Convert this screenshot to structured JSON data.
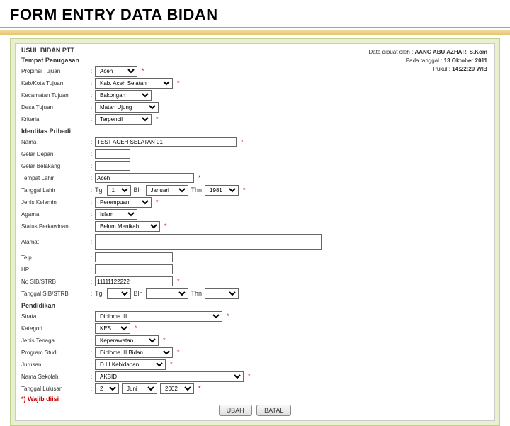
{
  "title": "FORM ENTRY DATA BIDAN",
  "form_header": "USUL BIDAN PTT",
  "meta": {
    "created_by_lbl": "Data dibuat oleh :",
    "created_by": "AANG ABU AZHAR, S.Kom",
    "date_lbl": "Pada tanggal :",
    "date": "13 Oktober 2011",
    "time_lbl": "Pukul :",
    "time": "14:22:20 WIB"
  },
  "sections": {
    "penugasan": "Tempat Penugasan",
    "identitas": "Identitas Pribadi",
    "pendidikan": "Pendidikan"
  },
  "labels": {
    "propinsi": "Propinsi Tujuan",
    "kab": "Kab/Kota Tujuan",
    "kec": "Kecamatan Tujuan",
    "desa": "Desa Tujuan",
    "kriteria": "Kriteria",
    "nama": "Nama",
    "gelar_depan": "Gelar Depan",
    "gelar_belakang": "Gelar Belakang",
    "tempat_lahir": "Tempat Lahir",
    "tanggal_lahir": "Tanggal Lahir",
    "jenis_kelamin": "Jenis Kelamin",
    "agama": "Agama",
    "status": "Status Perkawinan",
    "alamat": "Alamat",
    "telp": "Telp",
    "hp": "HP",
    "no_sib": "No SIB/STRB",
    "tgl_sib": "Tanggal SIB/STRB",
    "strata": "Strata",
    "kategori": "Kategori",
    "jenis_tenaga": "Jenis Tenaga",
    "prodi": "Program Studi",
    "jurusan": "Jurusan",
    "sekolah": "Nama Sekolah",
    "lulusan": "Tanggal Lulusan"
  },
  "values": {
    "propinsi": "Aceh",
    "kab": "Kab. Aceh Selatan",
    "kec": "Bakongan",
    "desa": "Matan Ujung",
    "kriteria": "Terpencil",
    "nama": "TEST ACEH SELATAN 01",
    "gelar_depan": "",
    "gelar_belakang": "",
    "tempat_lahir": "Aceh",
    "tgl": "1",
    "bln": "Januari",
    "thn": "1981",
    "jk": "Perempuan",
    "agama": "Islam",
    "status": "Belum Menikah",
    "alamat": "",
    "telp": "",
    "hp": "",
    "no_sib": "11111122222",
    "sib_tgl": "",
    "sib_bln": "",
    "sib_thn": "",
    "strata": "Diploma III",
    "kategori": "KES",
    "jenis_tenaga": "Keperawatan",
    "prodi": "Diploma III Bidan",
    "jurusan": "D.III Kebidanan",
    "sekolah": "AKBID",
    "lul_tgl": "2",
    "lul_bln": "Juni",
    "lul_thn": "2002"
  },
  "ui": {
    "tgl": "Tgl",
    "bln": "Bln",
    "thn": "Thn",
    "req_note": "*) Wajib diisi",
    "ubah": "UBAH",
    "batal": "BATAL"
  }
}
